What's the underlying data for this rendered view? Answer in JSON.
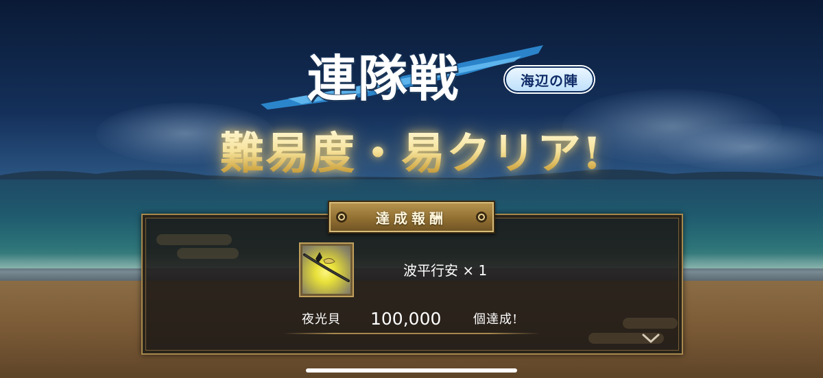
{
  "title": {
    "main": "連隊戦",
    "badge": "海辺の陣",
    "headline": "難易度・易クリア!"
  },
  "panel": {
    "tab_label": "達成報酬",
    "reward": {
      "icon": "katana-icon",
      "name_text": "波平行安 × 1"
    },
    "achievement": {
      "label": "夜光貝",
      "value": "100,000",
      "suffix": "個達成!"
    }
  },
  "colors": {
    "panel_border": "#a88a4e",
    "headline_gold": "#f3dd91",
    "badge_blue": "#bfe0fb"
  }
}
